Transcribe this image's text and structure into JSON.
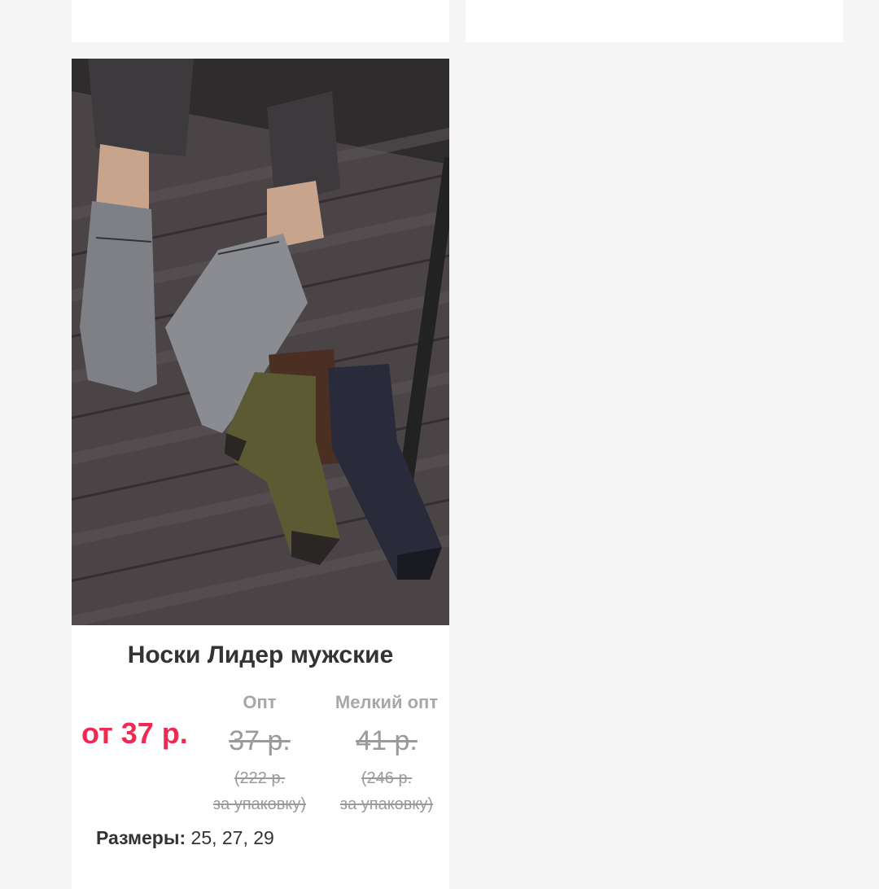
{
  "product": {
    "title": "Носки Лидер мужские",
    "price_from": "от 37 р.",
    "columns": [
      {
        "header": "Опт",
        "price": "37 р.",
        "pack_line1": "(222 р.",
        "pack_line2": "за упаковку)"
      },
      {
        "header": "Мелкий опт",
        "price": "41 р.",
        "pack_line1": "(246 р.",
        "pack_line2": "за упаковку)"
      }
    ],
    "sizes_label": "Размеры:",
    "sizes_value": "25, 27, 29",
    "image_alt": "product-photo-socks"
  },
  "colors": {
    "accent": "#ee2a52",
    "background": "#f5f5f5",
    "card": "#ffffff"
  }
}
